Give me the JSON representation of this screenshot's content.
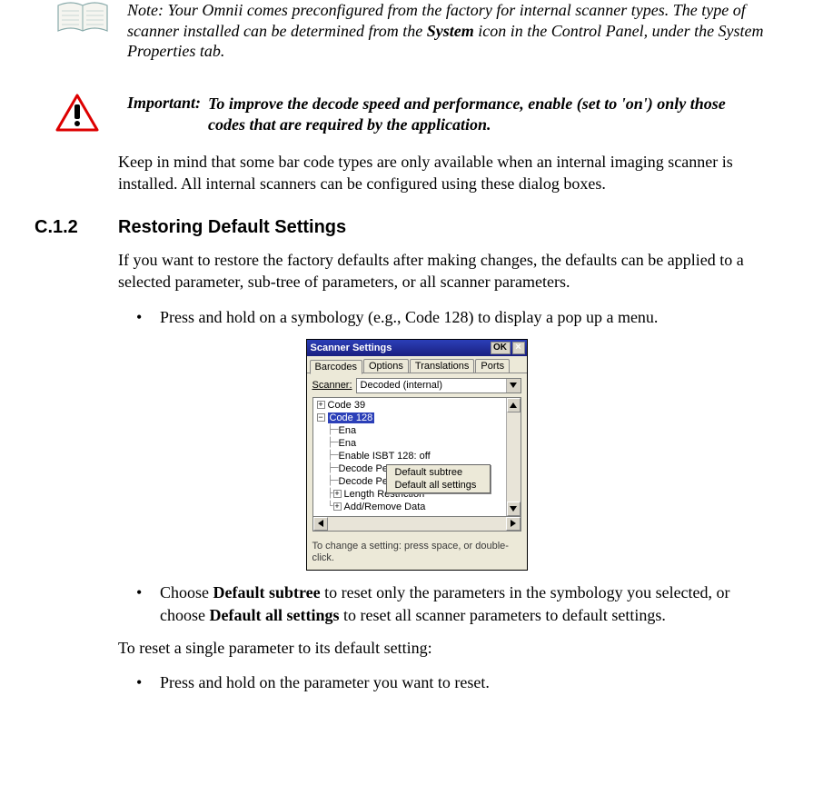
{
  "note": {
    "prefix": "Note:",
    "text_before_bold": " Your Omnii comes preconfigured from the factory for internal scanner types. The type of scanner installed can be determined from the ",
    "bold_word": "System",
    "text_after_bold": " icon in the Control Panel, under the System Properties tab."
  },
  "important": {
    "label": "Important:",
    "text": "To improve the decode speed and performance, enable (set to 'on') only those codes that are required by the application."
  },
  "para1": "Keep in mind that some bar code types are only available when an internal imaging scanner is installed. All internal scanners can be configured using these dialog boxes.",
  "section": {
    "number": "C.1.2",
    "title": "Restoring Default Settings"
  },
  "para2": "If you want to restore the factory defaults after making changes, the defaults can be applied to a selected parameter, sub-tree of parameters, or all scanner parameters.",
  "bullet1": "Press and hold on a symbology (e.g., Code 128) to display a pop up a menu.",
  "bullet2_pre": "Choose ",
  "bullet2_b1": "Default subtree",
  "bullet2_mid": " to reset only the parameters in the symbology you selected, or choose ",
  "bullet2_b2": "Default all settings",
  "bullet2_post": " to reset all scanner parameters to default settings.",
  "para3": "To reset a single parameter to its default setting:",
  "bullet3": "Press and hold on the parameter you want to reset.",
  "shot": {
    "title": "Scanner Settings",
    "ok": "OK",
    "close": "×",
    "tabs": [
      "Barcodes",
      "Options",
      "Translations",
      "Ports"
    ],
    "scanner_label": "Scanner:",
    "scanner_value": "Decoded (internal)",
    "tree": {
      "code39": "Code 39",
      "code128": "Code 128",
      "ena1": "Ena",
      "ena2": "Ena",
      "isbt": "Enable ISBT 128: off",
      "decperf": "Decode Performance: on",
      "decperflvl": "Decode Perf. Level: 1",
      "lenrest": "Length Restriction",
      "addrem": "Add/Remove Data"
    },
    "menu": {
      "item1": "Default subtree",
      "item2": "Default all settings"
    },
    "hint": "To change a setting: press space, or double-click."
  }
}
